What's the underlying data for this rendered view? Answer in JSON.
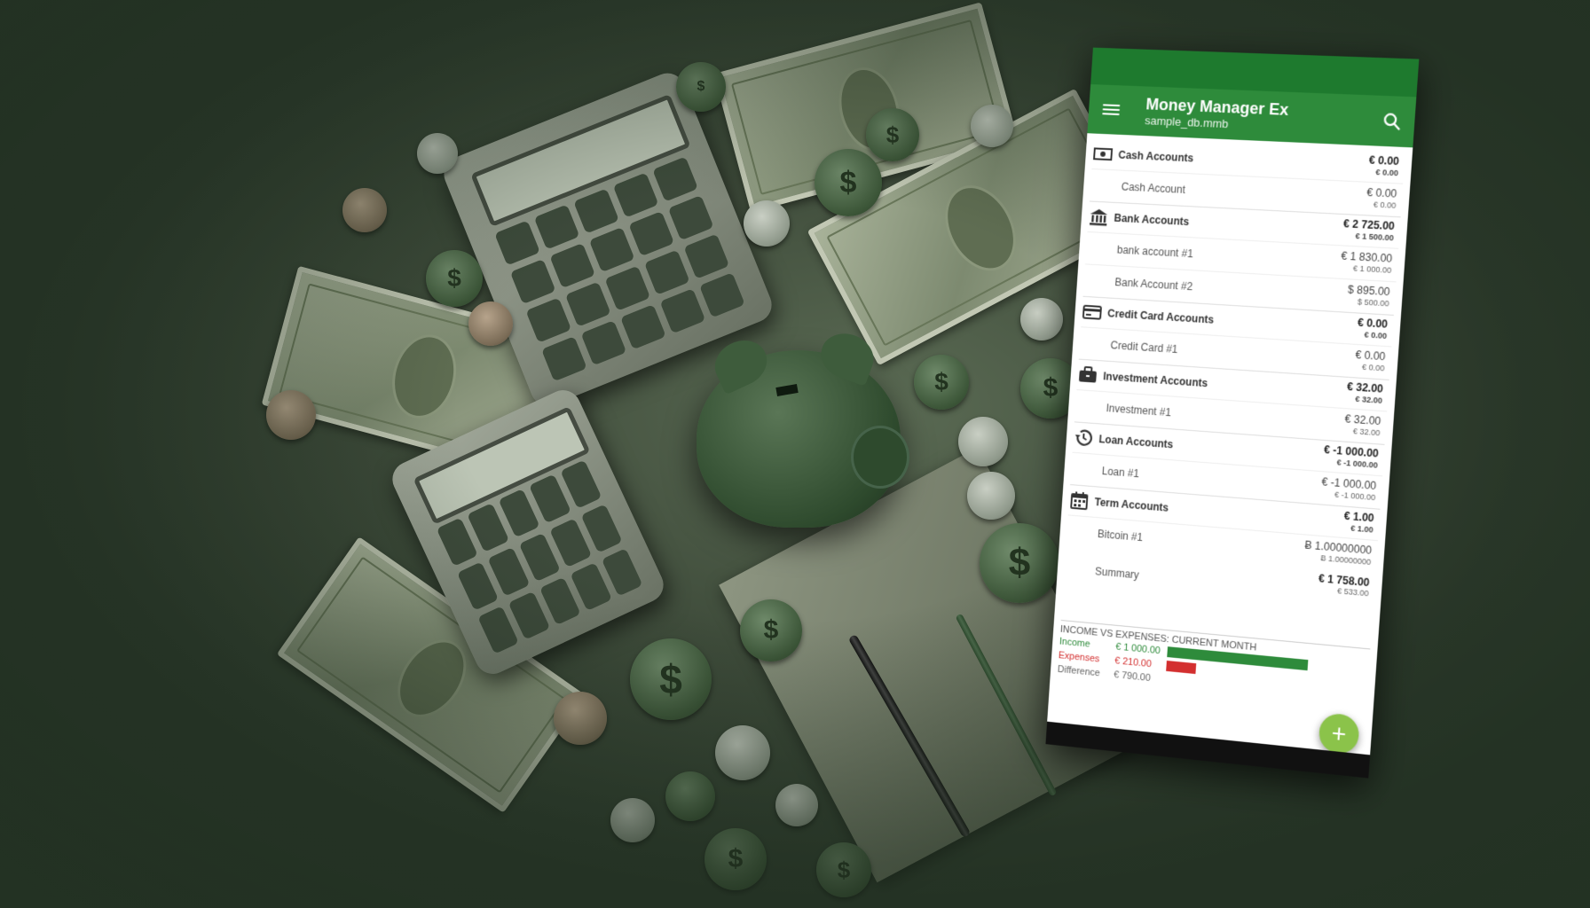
{
  "app": {
    "title": "Money Manager Ex",
    "subtitle": "sample_db.mmb",
    "icons": {
      "menu": "menu-icon",
      "search": "search-icon",
      "add": "plus-icon"
    },
    "colors": {
      "appbar": "#2e8b3b",
      "statusbar": "#1e7a2e",
      "fab": "#8bc34a",
      "income": "#2e8b3b",
      "expenses": "#d32f2f"
    }
  },
  "groups": [
    {
      "name": "Cash Accounts",
      "icon": "banknote-icon",
      "balance": "€ 0.00",
      "balance_base": "€ 0.00",
      "accounts": [
        {
          "name": "Cash Account",
          "balance": "€ 0.00",
          "balance_base": "€ 0.00"
        }
      ]
    },
    {
      "name": "Bank Accounts",
      "icon": "bank-icon",
      "balance": "€ 2 725.00",
      "balance_base": "€ 1 500.00",
      "accounts": [
        {
          "name": "bank account #1",
          "balance": "€ 1 830.00",
          "balance_base": "€ 1 000.00"
        },
        {
          "name": "Bank Account #2",
          "balance": "$ 895.00",
          "balance_base": "$ 500.00"
        }
      ]
    },
    {
      "name": "Credit Card Accounts",
      "icon": "credit-card-icon",
      "balance": "€ 0.00",
      "balance_base": "€ 0.00",
      "accounts": [
        {
          "name": "Credit Card #1",
          "balance": "€ 0.00",
          "balance_base": "€ 0.00"
        }
      ]
    },
    {
      "name": "Investment Accounts",
      "icon": "briefcase-icon",
      "balance": "€ 32.00",
      "balance_base": "€ 32.00",
      "accounts": [
        {
          "name": "Investment #1",
          "balance": "€ 32.00",
          "balance_base": "€ 32.00"
        }
      ]
    },
    {
      "name": "Loan Accounts",
      "icon": "history-icon",
      "balance": "€ -1 000.00",
      "balance_base": "€ -1 000.00",
      "accounts": [
        {
          "name": "Loan #1",
          "balance": "€ -1 000.00",
          "balance_base": "€ -1 000.00"
        }
      ]
    },
    {
      "name": "Term Accounts",
      "icon": "calendar-icon",
      "balance": "€ 1.00",
      "balance_base": "€ 1.00",
      "accounts": [
        {
          "name": "Bitcoin #1",
          "balance": "Ƀ 1.00000000",
          "balance_base": "Ƀ 1.00000000"
        }
      ]
    }
  ],
  "summary": {
    "label": "Summary",
    "balance": "€ 1 758.00",
    "balance_base": "€ 533.00"
  },
  "income_vs_expenses": {
    "title": "INCOME VS EXPENSES: CURRENT MONTH",
    "income_label": "Income",
    "income": "€ 1 000.00",
    "income_fraction": 1.0,
    "expenses_label": "Expenses",
    "expenses": "€ 210.00",
    "expenses_fraction": 0.21,
    "difference_label": "Difference",
    "difference": "€ 790.00"
  }
}
